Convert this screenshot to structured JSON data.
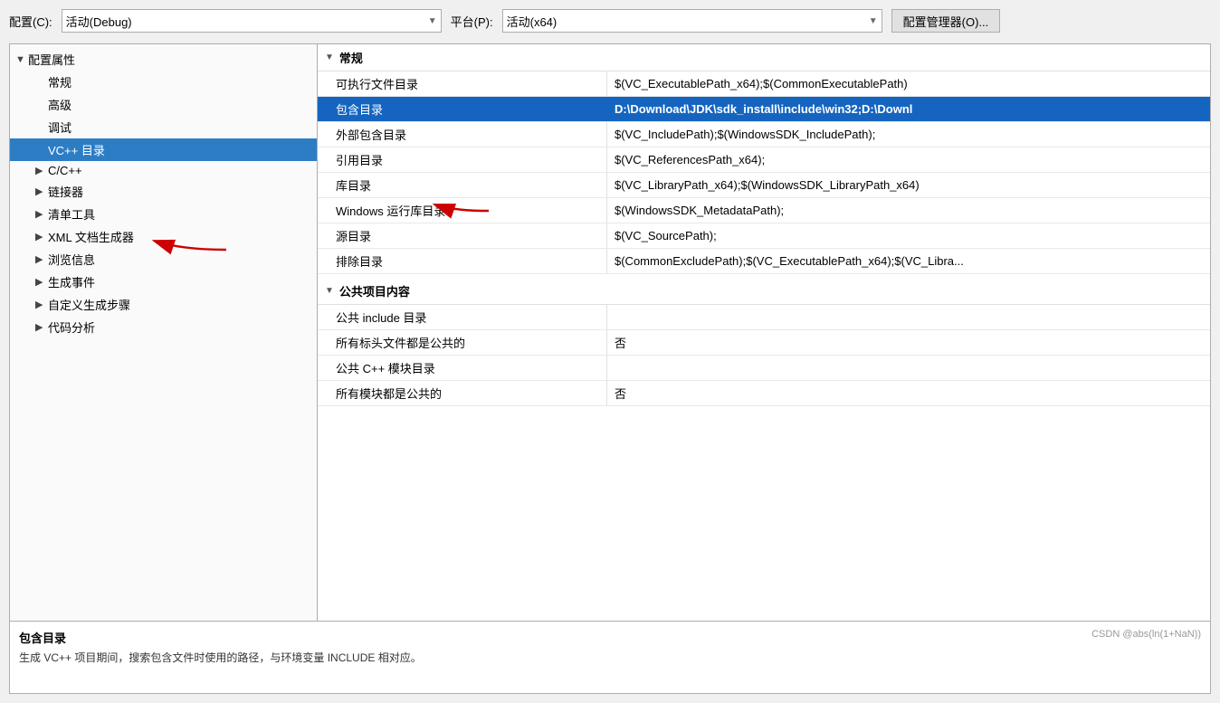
{
  "toolbar": {
    "config_label": "配置(C):",
    "config_value": "活动(Debug)",
    "platform_label": "平台(P):",
    "platform_value": "活动(x64)",
    "config_manager_label": "配置管理器(O)..."
  },
  "tree": {
    "root_label": "配置属性",
    "items": [
      {
        "id": "general",
        "label": "常规",
        "level": "child",
        "expandable": false
      },
      {
        "id": "advanced",
        "label": "高级",
        "level": "child",
        "expandable": false
      },
      {
        "id": "debug",
        "label": "调试",
        "level": "child",
        "expandable": false
      },
      {
        "id": "vc_dirs",
        "label": "VC++ 目录",
        "level": "child",
        "expandable": false,
        "selected": true
      },
      {
        "id": "cpp",
        "label": "C/C++",
        "level": "child",
        "expandable": true
      },
      {
        "id": "linker",
        "label": "链接器",
        "level": "child",
        "expandable": true
      },
      {
        "id": "manifest",
        "label": "清单工具",
        "level": "child",
        "expandable": true
      },
      {
        "id": "xml",
        "label": "XML 文档生成器",
        "level": "child",
        "expandable": true
      },
      {
        "id": "browse",
        "label": "浏览信息",
        "level": "child",
        "expandable": true
      },
      {
        "id": "build_events",
        "label": "生成事件",
        "level": "child",
        "expandable": true
      },
      {
        "id": "custom_build",
        "label": "自定义生成步骤",
        "level": "child",
        "expandable": true
      },
      {
        "id": "code_analysis",
        "label": "代码分析",
        "level": "child",
        "expandable": true
      }
    ]
  },
  "sections": {
    "general": {
      "title": "常规",
      "properties": [
        {
          "id": "executable_path",
          "name": "可执行文件目录",
          "value": "$(VC_ExecutablePath_x64);$(CommonExecutablePath)"
        },
        {
          "id": "include_dirs",
          "name": "包含目录",
          "value": "D:\\Download\\JDK\\sdk_install\\include\\win32;D:\\Downl...",
          "selected": true,
          "bold_value": true
        },
        {
          "id": "external_include",
          "name": "外部包含目录",
          "value": "$(VC_IncludePath);$(WindowsSDK_IncludePath);"
        },
        {
          "id": "reference_dirs",
          "name": "引用目录",
          "value": "$(VC_ReferencesPath_x64);"
        },
        {
          "id": "library_dirs",
          "name": "库目录",
          "value": "$(VC_LibraryPath_x64);$(WindowsSDK_LibraryPath_x64)"
        },
        {
          "id": "windows_runtime",
          "name": "Windows 运行库目录",
          "value": "$(WindowsSDK_MetadataPath);"
        },
        {
          "id": "source_dirs",
          "name": "源目录",
          "value": "$(VC_SourcePath);"
        },
        {
          "id": "exclude_dirs",
          "name": "排除目录",
          "value": "$(CommonExcludePath);$(VC_ExecutablePath_x64);$(VC_Libra..."
        }
      ]
    },
    "public": {
      "title": "公共项目内容",
      "properties": [
        {
          "id": "public_include",
          "name": "公共 include 目录",
          "value": ""
        },
        {
          "id": "all_headers_public",
          "name": "所有标头文件都是公共的",
          "value": "否"
        },
        {
          "id": "public_cpp_module",
          "name": "公共 C++ 模块目录",
          "value": ""
        },
        {
          "id": "all_modules_public",
          "name": "所有模块都是公共的",
          "value": "否"
        }
      ]
    }
  },
  "bottom": {
    "title": "包含目录",
    "description": "生成 VC++ 项目期间，搜索包含文件时使用的路径，与环境变量 INCLUDE 相对应。",
    "watermark": "CSDN @abs(ln(1+NaN))"
  }
}
